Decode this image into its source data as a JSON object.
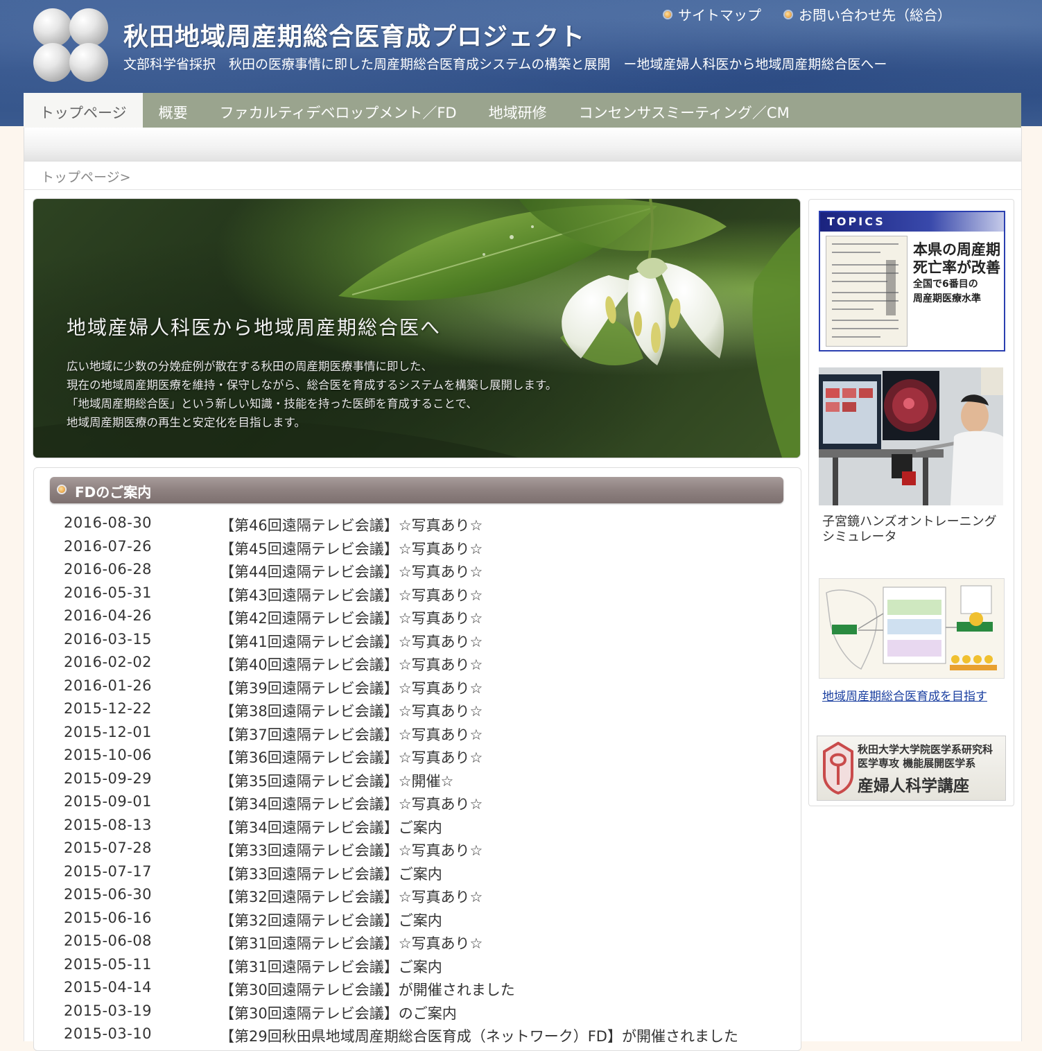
{
  "header": {
    "title": "秋田地域周産期総合医育成プロジェクト",
    "subtitle": "文部科学省採択　秋田の医療事情に即した周産期総合医育成システムの構築と展開　ー地域産婦人科医から地域周産期総合医へー",
    "links": [
      "サイトマップ",
      "お問い合わせ先（総合）"
    ]
  },
  "nav": {
    "items": [
      "トップページ",
      "概要",
      "ファカルティデベロップメント／FD",
      "地域研修",
      "コンセンサスミーティング／CM"
    ],
    "active_index": 0
  },
  "breadcrumb": "トップページ>",
  "hero": {
    "title": "地域産婦人科医から地域周産期総合医へ",
    "lines": [
      "広い地域に少数の分娩症例が散在する秋田の周産期医療事情に即した、",
      "現在の地域周産期医療を維持・保守しながら、総合医を育成するシステムを構築し展開します。",
      "「地域周産期総合医」という新しい知識・技能を持った医師を育成することで、",
      "地域周産期医療の再生と安定化を目指します。"
    ]
  },
  "fd": {
    "title": "FDのご案内",
    "items": [
      {
        "date": "2016-08-30",
        "text": "【第46回遠隔テレビ会議】☆写真あり☆"
      },
      {
        "date": "2016-07-26",
        "text": "【第45回遠隔テレビ会議】☆写真あり☆"
      },
      {
        "date": "2016-06-28",
        "text": "【第44回遠隔テレビ会議】☆写真あり☆"
      },
      {
        "date": "2016-05-31",
        "text": "【第43回遠隔テレビ会議】☆写真あり☆"
      },
      {
        "date": "2016-04-26",
        "text": "【第42回遠隔テレビ会議】☆写真あり☆"
      },
      {
        "date": "2016-03-15",
        "text": "【第41回遠隔テレビ会議】☆写真あり☆"
      },
      {
        "date": "2016-02-02",
        "text": "【第40回遠隔テレビ会議】☆写真あり☆"
      },
      {
        "date": "2016-01-26",
        "text": "【第39回遠隔テレビ会議】☆写真あり☆"
      },
      {
        "date": "2015-12-22",
        "text": "【第38回遠隔テレビ会議】☆写真あり☆"
      },
      {
        "date": "2015-12-01",
        "text": "【第37回遠隔テレビ会議】☆写真あり☆"
      },
      {
        "date": "2015-10-06",
        "text": "【第36回遠隔テレビ会議】☆写真あり☆"
      },
      {
        "date": "2015-09-29",
        "text": "【第35回遠隔テレビ会議】☆開催☆"
      },
      {
        "date": "2015-09-01",
        "text": "【第34回遠隔テレビ会議】☆写真あり☆"
      },
      {
        "date": "2015-08-13",
        "text": "【第34回遠隔テレビ会議】ご案内"
      },
      {
        "date": "2015-07-28",
        "text": "【第33回遠隔テレビ会議】☆写真あり☆"
      },
      {
        "date": "2015-07-17",
        "text": "【第33回遠隔テレビ会議】ご案内"
      },
      {
        "date": "2015-06-30",
        "text": "【第32回遠隔テレビ会議】☆写真あり☆"
      },
      {
        "date": "2015-06-16",
        "text": "【第32回遠隔テレビ会議】ご案内"
      },
      {
        "date": "2015-06-08",
        "text": "【第31回遠隔テレビ会議】☆写真あり☆"
      },
      {
        "date": "2015-05-11",
        "text": "【第31回遠隔テレビ会議】ご案内"
      },
      {
        "date": "2015-04-14",
        "text": "【第30回遠隔テレビ会議】が開催されました"
      },
      {
        "date": "2015-03-19",
        "text": "【第30回遠隔テレビ会議】のご案内"
      },
      {
        "date": "2015-03-10",
        "text": "【第29回秋田県地域周産期総合医育成（ネットワーク）FD】が開催されました"
      }
    ]
  },
  "sidebar": {
    "topics": {
      "label": "TOPICS",
      "head1": "本県の周産期",
      "head2": "死亡率が改善",
      "sub1": "全国で6番目の",
      "sub2": "周産期医療水準"
    },
    "simulator_caption": "子宮鏡ハンズオントレーニングシミュレータ",
    "diagram_link": "地域周産期総合医育成を目指す",
    "dept": {
      "line1": "秋田大学大学院医学系研究科",
      "line2": "医学専攻 機能展開医学系",
      "line3": "産婦人科学講座"
    }
  },
  "colors": {
    "header_blue": "#2f4f86",
    "nav_green": "#9aa48e",
    "fd_header": "#8e8180",
    "link_blue": "#1a3fa0",
    "topics_border": "#2a3fb0"
  }
}
